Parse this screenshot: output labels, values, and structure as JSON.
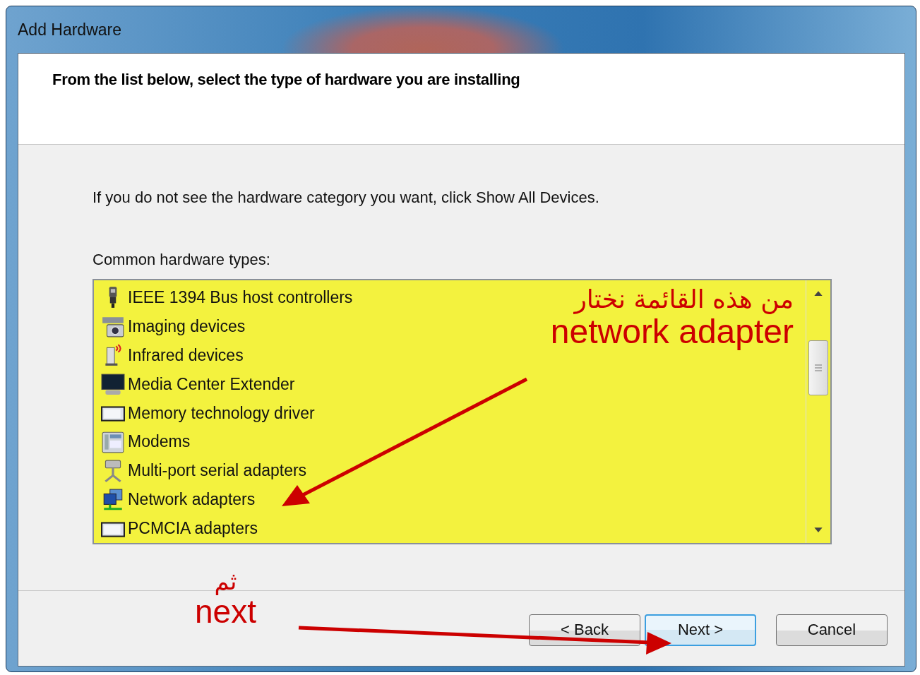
{
  "window": {
    "title": "Add Hardware"
  },
  "header": {
    "heading": "From the list below, select the type of hardware you are installing"
  },
  "body": {
    "instruction": "If you do not see the hardware category you want, click Show All Devices.",
    "list_label": "Common hardware types:"
  },
  "hardware_list": [
    {
      "label": "IEEE 1394 Bus host controllers",
      "kind": "plug"
    },
    {
      "label": "Imaging devices",
      "kind": "camera"
    },
    {
      "label": "Infrared devices",
      "kind": "infrared"
    },
    {
      "label": "Media Center Extender",
      "kind": "monitor"
    },
    {
      "label": "Memory technology driver",
      "kind": "card"
    },
    {
      "label": "Modems",
      "kind": "phone"
    },
    {
      "label": "Multi-port serial adapters",
      "kind": "hub"
    },
    {
      "label": "Network adapters",
      "kind": "network"
    },
    {
      "label": "PCMCIA adapters",
      "kind": "card"
    }
  ],
  "annotations": {
    "list_note_arabic": "من هذه القائمة نختار",
    "list_note": "network adapter",
    "footer_note_arabic": "ثم",
    "footer_note": "next"
  },
  "buttons": [
    {
      "label": "< Back",
      "default": false
    },
    {
      "label": "Next >",
      "default": true
    },
    {
      "label": "Cancel",
      "default": false
    }
  ]
}
